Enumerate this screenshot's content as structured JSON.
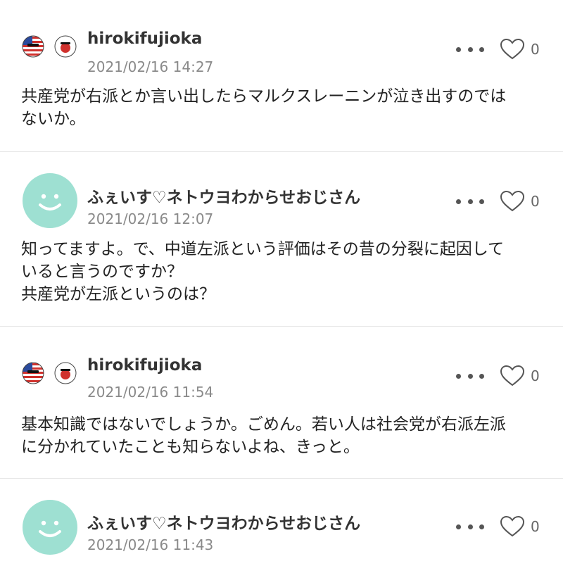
{
  "comments": [
    {
      "username": "hirokifujioka",
      "timestamp": "2021/02/16 14:27",
      "likes": "0",
      "lines": [
        "共産党が右派とか言い出したらマルクスレーニンが泣き出すのでは",
        "ないか。"
      ]
    },
    {
      "username": "ふぇいす♡ネトウヨわからせおじさん",
      "timestamp": "2021/02/16 12:07",
      "likes": "0",
      "lines": [
        "知ってますよ。で、中道左派という評価はその昔の分裂に起因して",
        "いると言うのですか？",
        "共産党が左派というのは？"
      ]
    },
    {
      "username": "hirokifujioka",
      "timestamp": "2021/02/16 11:54",
      "likes": "0",
      "lines": [
        "基本知識ではないでしょうか。ごめん。若い人は社会党が右派左派",
        "に分かれていたことも知らないよね、きっと。"
      ]
    },
    {
      "username": "ふぇいす♡ネトウヨわからせおじさん",
      "timestamp": "2021/02/16 11:43",
      "likes": "0",
      "lines": []
    }
  ],
  "colors": {
    "avatar": "#9ee0d2",
    "meta": "#8a8a8a",
    "divider": "#e6e6e6"
  },
  "icons": [
    "usa-ball-icon",
    "japan-ball-icon",
    "smiley-avatar-icon",
    "more-dots-icon",
    "heart-icon"
  ]
}
